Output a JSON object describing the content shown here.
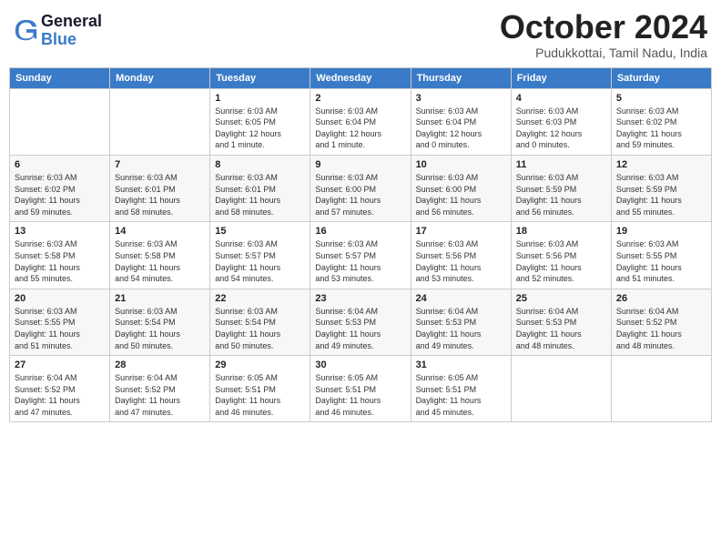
{
  "logo": {
    "line1": "General",
    "line2": "Blue"
  },
  "title": "October 2024",
  "location": "Pudukkottai, Tamil Nadu, India",
  "days_header": [
    "Sunday",
    "Monday",
    "Tuesday",
    "Wednesday",
    "Thursday",
    "Friday",
    "Saturday"
  ],
  "weeks": [
    [
      {
        "num": "",
        "info": ""
      },
      {
        "num": "",
        "info": ""
      },
      {
        "num": "1",
        "info": "Sunrise: 6:03 AM\nSunset: 6:05 PM\nDaylight: 12 hours\nand 1 minute."
      },
      {
        "num": "2",
        "info": "Sunrise: 6:03 AM\nSunset: 6:04 PM\nDaylight: 12 hours\nand 1 minute."
      },
      {
        "num": "3",
        "info": "Sunrise: 6:03 AM\nSunset: 6:04 PM\nDaylight: 12 hours\nand 0 minutes."
      },
      {
        "num": "4",
        "info": "Sunrise: 6:03 AM\nSunset: 6:03 PM\nDaylight: 12 hours\nand 0 minutes."
      },
      {
        "num": "5",
        "info": "Sunrise: 6:03 AM\nSunset: 6:02 PM\nDaylight: 11 hours\nand 59 minutes."
      }
    ],
    [
      {
        "num": "6",
        "info": "Sunrise: 6:03 AM\nSunset: 6:02 PM\nDaylight: 11 hours\nand 59 minutes."
      },
      {
        "num": "7",
        "info": "Sunrise: 6:03 AM\nSunset: 6:01 PM\nDaylight: 11 hours\nand 58 minutes."
      },
      {
        "num": "8",
        "info": "Sunrise: 6:03 AM\nSunset: 6:01 PM\nDaylight: 11 hours\nand 58 minutes."
      },
      {
        "num": "9",
        "info": "Sunrise: 6:03 AM\nSunset: 6:00 PM\nDaylight: 11 hours\nand 57 minutes."
      },
      {
        "num": "10",
        "info": "Sunrise: 6:03 AM\nSunset: 6:00 PM\nDaylight: 11 hours\nand 56 minutes."
      },
      {
        "num": "11",
        "info": "Sunrise: 6:03 AM\nSunset: 5:59 PM\nDaylight: 11 hours\nand 56 minutes."
      },
      {
        "num": "12",
        "info": "Sunrise: 6:03 AM\nSunset: 5:59 PM\nDaylight: 11 hours\nand 55 minutes."
      }
    ],
    [
      {
        "num": "13",
        "info": "Sunrise: 6:03 AM\nSunset: 5:58 PM\nDaylight: 11 hours\nand 55 minutes."
      },
      {
        "num": "14",
        "info": "Sunrise: 6:03 AM\nSunset: 5:58 PM\nDaylight: 11 hours\nand 54 minutes."
      },
      {
        "num": "15",
        "info": "Sunrise: 6:03 AM\nSunset: 5:57 PM\nDaylight: 11 hours\nand 54 minutes."
      },
      {
        "num": "16",
        "info": "Sunrise: 6:03 AM\nSunset: 5:57 PM\nDaylight: 11 hours\nand 53 minutes."
      },
      {
        "num": "17",
        "info": "Sunrise: 6:03 AM\nSunset: 5:56 PM\nDaylight: 11 hours\nand 53 minutes."
      },
      {
        "num": "18",
        "info": "Sunrise: 6:03 AM\nSunset: 5:56 PM\nDaylight: 11 hours\nand 52 minutes."
      },
      {
        "num": "19",
        "info": "Sunrise: 6:03 AM\nSunset: 5:55 PM\nDaylight: 11 hours\nand 51 minutes."
      }
    ],
    [
      {
        "num": "20",
        "info": "Sunrise: 6:03 AM\nSunset: 5:55 PM\nDaylight: 11 hours\nand 51 minutes."
      },
      {
        "num": "21",
        "info": "Sunrise: 6:03 AM\nSunset: 5:54 PM\nDaylight: 11 hours\nand 50 minutes."
      },
      {
        "num": "22",
        "info": "Sunrise: 6:03 AM\nSunset: 5:54 PM\nDaylight: 11 hours\nand 50 minutes."
      },
      {
        "num": "23",
        "info": "Sunrise: 6:04 AM\nSunset: 5:53 PM\nDaylight: 11 hours\nand 49 minutes."
      },
      {
        "num": "24",
        "info": "Sunrise: 6:04 AM\nSunset: 5:53 PM\nDaylight: 11 hours\nand 49 minutes."
      },
      {
        "num": "25",
        "info": "Sunrise: 6:04 AM\nSunset: 5:53 PM\nDaylight: 11 hours\nand 48 minutes."
      },
      {
        "num": "26",
        "info": "Sunrise: 6:04 AM\nSunset: 5:52 PM\nDaylight: 11 hours\nand 48 minutes."
      }
    ],
    [
      {
        "num": "27",
        "info": "Sunrise: 6:04 AM\nSunset: 5:52 PM\nDaylight: 11 hours\nand 47 minutes."
      },
      {
        "num": "28",
        "info": "Sunrise: 6:04 AM\nSunset: 5:52 PM\nDaylight: 11 hours\nand 47 minutes."
      },
      {
        "num": "29",
        "info": "Sunrise: 6:05 AM\nSunset: 5:51 PM\nDaylight: 11 hours\nand 46 minutes."
      },
      {
        "num": "30",
        "info": "Sunrise: 6:05 AM\nSunset: 5:51 PM\nDaylight: 11 hours\nand 46 minutes."
      },
      {
        "num": "31",
        "info": "Sunrise: 6:05 AM\nSunset: 5:51 PM\nDaylight: 11 hours\nand 45 minutes."
      },
      {
        "num": "",
        "info": ""
      },
      {
        "num": "",
        "info": ""
      }
    ]
  ]
}
